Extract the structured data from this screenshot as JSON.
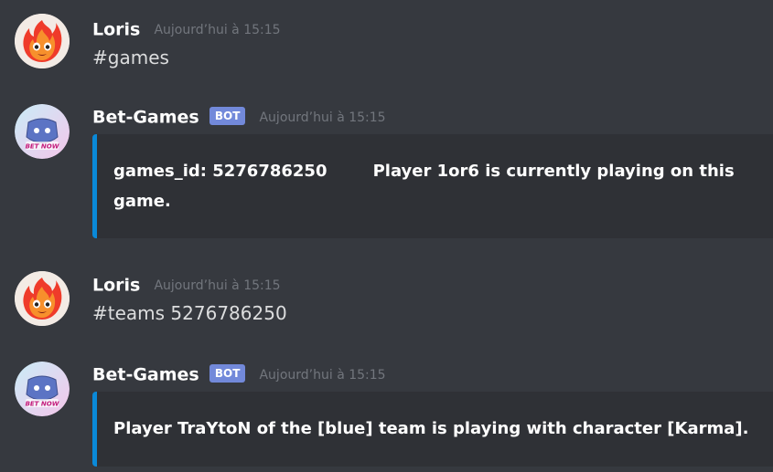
{
  "messages": [
    {
      "author": "Loris",
      "timestamp": "Aujourd’hui à 15:15",
      "content": "#games",
      "avatar_icon": "fire-icon"
    },
    {
      "author": "Bet-Games",
      "bot_tag": "BOT",
      "timestamp": "Aujourd’hui à 15:15",
      "embed_line1": "games_id: 5276786250        Player 1or6 is currently playing on this",
      "embed_line2": "game.",
      "avatar_icon": "discord-bot-icon",
      "avatar_text": "BET NOW",
      "embed_color": "#0a89d8"
    },
    {
      "author": "Loris",
      "timestamp": "Aujourd’hui à 15:15",
      "content": "#teams 5276786250",
      "avatar_icon": "fire-icon"
    },
    {
      "author": "Bet-Games",
      "bot_tag": "BOT",
      "timestamp": "Aujourd’hui à 15:15",
      "embed_line1": "Player TraYtoN of the [blue] team is playing with character [Karma].",
      "avatar_icon": "discord-bot-icon",
      "avatar_text": "BET NOW",
      "embed_color": "#0a89d8"
    }
  ],
  "colors": {
    "background": "#36393f",
    "embed_background": "#2f3136",
    "bot_tag": "#7289da",
    "timestamp": "#72767d"
  }
}
